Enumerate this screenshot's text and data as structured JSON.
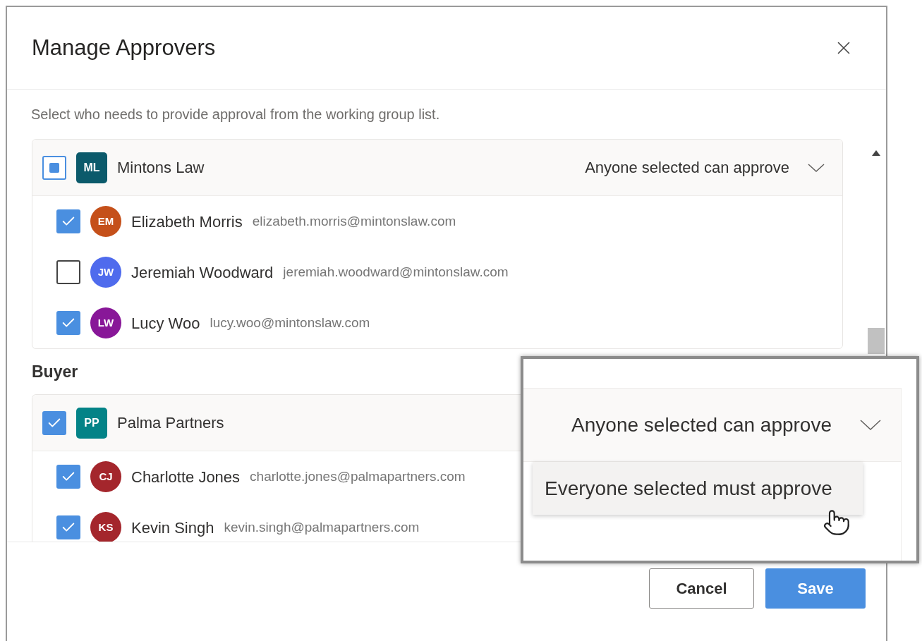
{
  "dialog": {
    "title": "Manage Approvers",
    "description": "Select who needs to provide approval from the working group list.",
    "groups": [
      {
        "organization": {
          "initials": "ML",
          "name": "Mintons Law",
          "color": "#0b5a6b",
          "checked": true,
          "partial": true
        },
        "approval_rule": "Anyone selected can approve",
        "members": [
          {
            "initials": "EM",
            "name": "Elizabeth Morris",
            "email": "elizabeth.morris@mintonslaw.com",
            "color": "#c5501a",
            "checked": true
          },
          {
            "initials": "JW",
            "name": "Jeremiah Woodward",
            "email": "jeremiah.woodward@mintonslaw.com",
            "color": "#4f6bed",
            "checked": false
          },
          {
            "initials": "LW",
            "name": "Lucy Woo",
            "email": "lucy.woo@mintonslaw.com",
            "color": "#881798",
            "checked": true
          }
        ]
      },
      {
        "section_label": "Buyer",
        "organization": {
          "initials": "PP",
          "name": "Palma Partners",
          "color": "#038387",
          "checked": true,
          "partial": false
        },
        "members": [
          {
            "initials": "CJ",
            "name": "Charlotte Jones",
            "email": "charlotte.jones@palmapartners.com",
            "color": "#a4262c",
            "checked": true
          },
          {
            "initials": "KS",
            "name": "Kevin Singh",
            "email": "kevin.singh@palmapartners.com",
            "color": "#a4262c",
            "checked": true
          }
        ]
      }
    ],
    "buttons": [
      {
        "label": "Cancel",
        "kind": "secondary"
      },
      {
        "label": "Save",
        "kind": "primary"
      }
    ]
  },
  "callout": {
    "dropdown_value": "Anyone selected can approve",
    "options": [
      {
        "label": "Everyone selected must approve",
        "highlighted": true
      }
    ]
  }
}
